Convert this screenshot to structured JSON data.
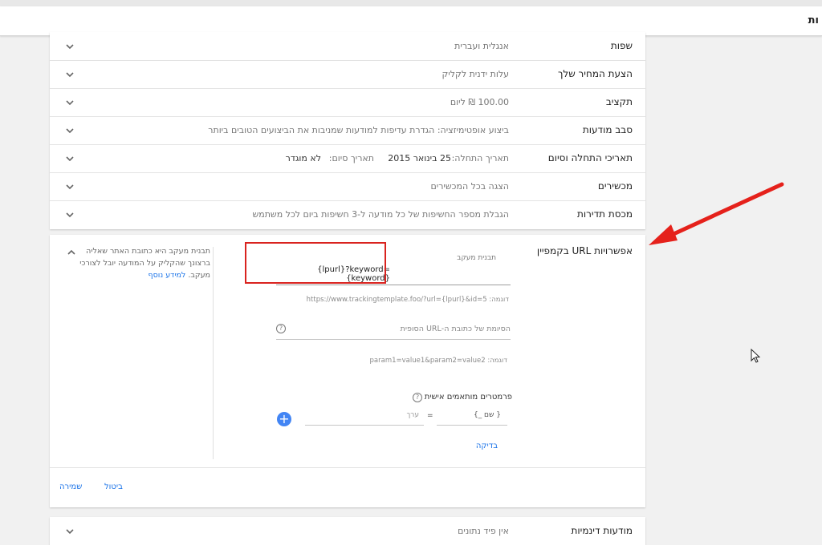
{
  "header": {
    "title": "ות"
  },
  "settings_rows": [
    {
      "label": "שפות",
      "value": "אנגלית ועברית"
    },
    {
      "label": "הצעת המחיר שלך",
      "value": "עלות ידנית לקליק"
    },
    {
      "label": "תקציב",
      "value": "100.00 ₪ ליום"
    },
    {
      "label": "סבב מודעות",
      "value": "ביצוע אופטימיזציה: הגדרת עדיפות למודעות שמניבות את הביצועים הטובים ביותר"
    },
    {
      "label": "תאריכי התחלה וסיום",
      "value_start_label": "תאריך התחלה:",
      "value_start": "25 בינואר 2015",
      "value_end_label": "תאריך סיום:",
      "value_end": "לא מוגדר"
    },
    {
      "label": "מכשירים",
      "value": "הצגה בכל המכשירים"
    },
    {
      "label": "מכסת תדירות",
      "value": "הגבלת מספר החשיפות של כל מודעה ל-3 חשיפות ביום לכל משתמש"
    }
  ],
  "url_options": {
    "title": "אפשרויות URL בקמפיין",
    "help_text": "תבנית מעקב היא כתובת האתר שאליה ברצונך שהקליק על המודעה יובל לצורכי מעקב.",
    "help_link": "למידע נוסף",
    "tracking_label": "תבנית מעקב",
    "tracking_value": "{lpurl}?keyword={keyword}",
    "tracking_example": "דוגמה: https://www.trackingtemplate.foo/?url={lpurl}&id=5",
    "suffix_placeholder": "הסיומת של כתובת ה-URL הסופית",
    "suffix_example": "דוגמה: param1=value1&param2=value2",
    "custom_params_label": "פרמטרים מותאמים אישית",
    "param_name_placeholder": "{ שם _}",
    "param_equals": "=",
    "param_value_placeholder": "ערך",
    "test_label": "בדיקה",
    "save_label": "שמירה",
    "cancel_label": "ביטול",
    "help_icon_glyph": "?"
  },
  "dynamic_row": {
    "label": "מודעות דינמיות",
    "value": "אין פיד נתונים"
  },
  "colors": {
    "accent": "#1a73e8",
    "annotation": "#d9231f",
    "add_button": "#4285f4"
  }
}
